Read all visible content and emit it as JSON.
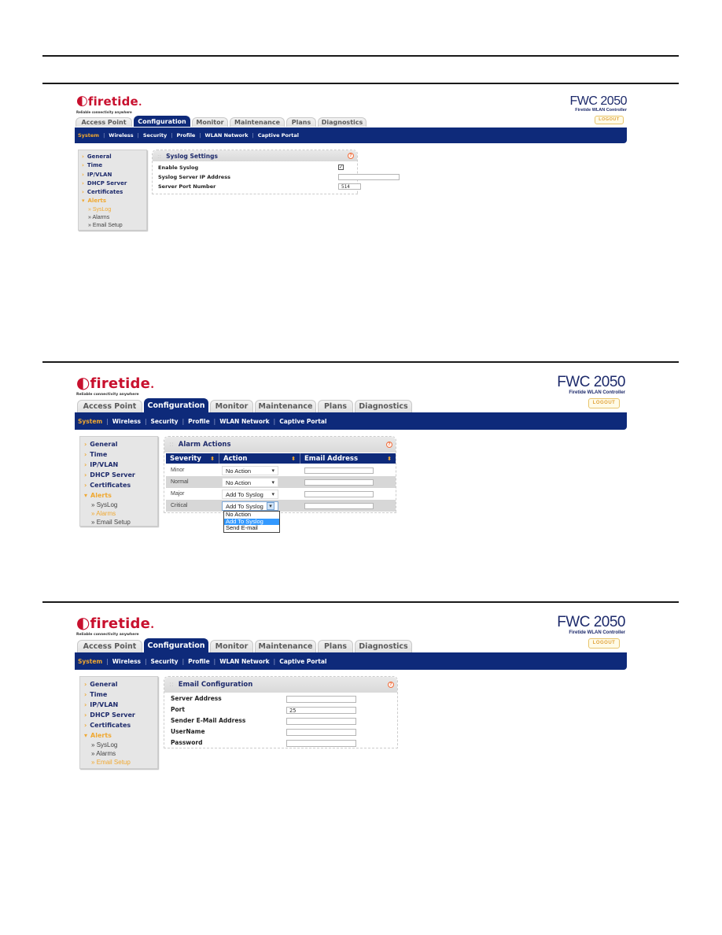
{
  "brand": {
    "logo_text": "firetide",
    "tagline": "Reliable connectivity anywhere",
    "product_name": "FWC 2050",
    "product_sub": "Firetide WLAN Controller",
    "logout_label": "LOGOUT"
  },
  "tabs": [
    "Access Point",
    "Configuration",
    "Monitor",
    "Maintenance",
    "Plans",
    "Diagnostics"
  ],
  "active_tab": "Configuration",
  "subnav": [
    "System",
    "Wireless",
    "Security",
    "Profile",
    "WLAN Network",
    "Captive Portal"
  ],
  "active_subnav": "System",
  "sidebar": {
    "items": [
      "General",
      "Time",
      "IP/VLAN",
      "DHCP Server",
      "Certificates",
      "Alerts"
    ],
    "alerts_sub": [
      "SysLog",
      "Alarms",
      "Email Setup"
    ]
  },
  "screens": [
    {
      "active_sidebar_sub": "SysLog",
      "panel_title": "Syslog Settings",
      "fields": [
        {
          "label": "Enable Syslog",
          "type": "checkbox",
          "checked": true
        },
        {
          "label": "Syslog Server IP Address",
          "type": "text",
          "value": ""
        },
        {
          "label": "Server Port Number",
          "type": "text",
          "value": "514"
        }
      ]
    },
    {
      "active_sidebar_sub": "Alarms",
      "panel_title": "Alarm Actions",
      "columns": [
        "Severity",
        "Action",
        "Email Address"
      ],
      "rows": [
        {
          "severity": "Minor",
          "action": "No Action",
          "email": ""
        },
        {
          "severity": "Normal",
          "action": "No Action",
          "email": ""
        },
        {
          "severity": "Major",
          "action": "Add To Syslog",
          "email": ""
        },
        {
          "severity": "Critical",
          "action": "Add To Syslog",
          "email": ""
        }
      ],
      "open_dropdown": {
        "row": "Critical",
        "options": [
          "No Action",
          "Add To Syslog",
          "Send E-mail"
        ],
        "highlighted": "Add To Syslog"
      }
    },
    {
      "active_sidebar_sub": "Email Setup",
      "panel_title": "Email Configuration",
      "fields": [
        {
          "label": "Server Address",
          "value": ""
        },
        {
          "label": "Port",
          "value": "25"
        },
        {
          "label": "Sender E-Mail Address",
          "value": ""
        },
        {
          "label": "UserName",
          "value": ""
        },
        {
          "label": "Password",
          "value": ""
        }
      ]
    }
  ],
  "icons": {
    "help": "?",
    "checkmark": "✓",
    "sort": "⬍",
    "chevron_down": "▾",
    "sidebar_arrow": "›",
    "submenu_bullet": "»"
  }
}
